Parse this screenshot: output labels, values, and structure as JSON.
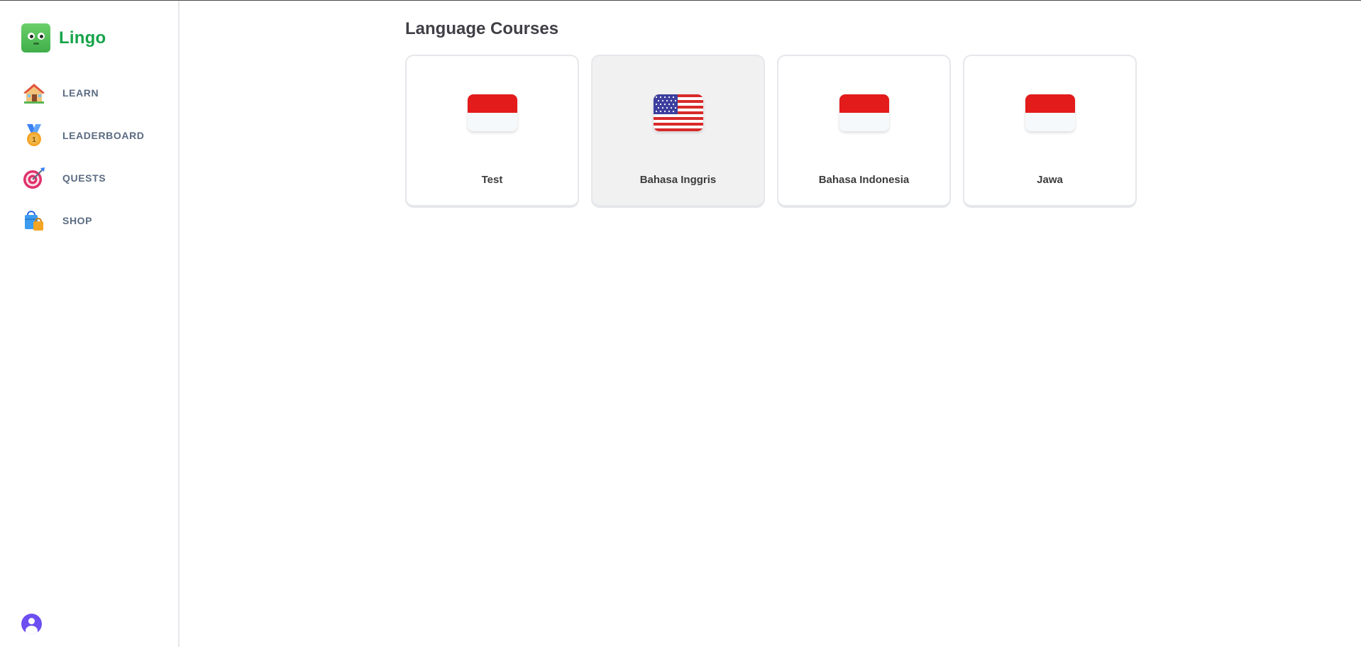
{
  "app": {
    "name": "Lingo",
    "brand_color": "#16a34a"
  },
  "sidebar": {
    "items": [
      {
        "label": "LEARN",
        "icon": "house-icon"
      },
      {
        "label": "LEADERBOARD",
        "icon": "medal-icon"
      },
      {
        "label": "QUESTS",
        "icon": "target-icon"
      },
      {
        "label": "SHOP",
        "icon": "shopping-bags-icon"
      }
    ],
    "user": {
      "icon": "user-avatar-icon",
      "color": "#6d4ef0"
    }
  },
  "main": {
    "title": "Language Courses",
    "courses": [
      {
        "name": "Test",
        "flag": "indonesia-flag-icon",
        "active": false
      },
      {
        "name": "Bahasa Inggris",
        "flag": "us-flag-icon",
        "active": true
      },
      {
        "name": "Bahasa Indonesia",
        "flag": "indonesia-flag-icon",
        "active": false
      },
      {
        "name": "Jawa",
        "flag": "indonesia-flag-icon",
        "active": false
      }
    ]
  }
}
